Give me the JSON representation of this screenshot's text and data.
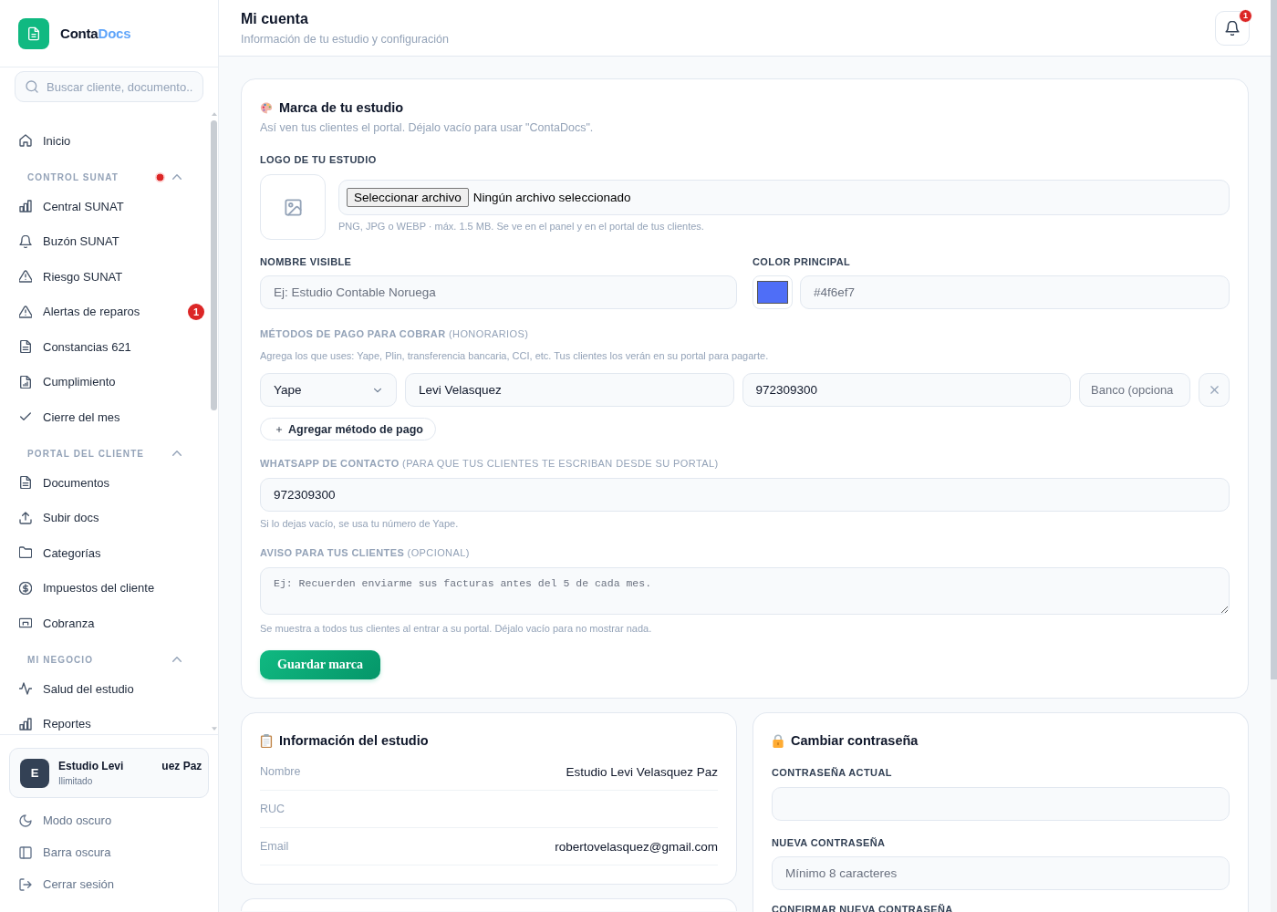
{
  "sidebar": {
    "brand": {
      "name_start": "Conta",
      "name_end": "Docs"
    },
    "search": {
      "placeholder": "Buscar cliente, documento.."
    },
    "nav_top": [
      {
        "label": "Inicio",
        "selected": false
      }
    ],
    "nav_sections": [
      {
        "title": "CONTROL SUNAT",
        "alert_dot": true,
        "expanded": true,
        "items": [
          {
            "label": "Central SUNAT",
            "selected": false
          },
          {
            "label": "Buzón SUNAT",
            "selected": false
          },
          {
            "label": "Riesgo SUNAT",
            "selected": false
          },
          {
            "label": "Alertas de reparos",
            "badge": "1",
            "selected": false
          },
          {
            "label": "Constancias 621",
            "selected": false
          },
          {
            "label": "Cumplimiento",
            "selected": false
          },
          {
            "label": "Cierre del mes",
            "selected": false
          }
        ]
      },
      {
        "title": "PORTAL DEL CLIENTE",
        "alert_dot": false,
        "expanded": true,
        "items": [
          {
            "label": "Documentos",
            "selected": false
          },
          {
            "label": "Subir docs",
            "selected": false
          },
          {
            "label": "Categorías",
            "selected": false
          },
          {
            "label": "Impuestos del cliente",
            "selected": false
          },
          {
            "label": "Cobranza",
            "selected": false
          }
        ]
      },
      {
        "title": "MI NEGOCIO",
        "alert_dot": false,
        "expanded": true,
        "items": [
          {
            "label": "Salud del estudio",
            "selected": false
          },
          {
            "label": "Reportes",
            "selected": false
          }
        ]
      }
    ],
    "account": {
      "initial": "E",
      "name_start": "Estudio Levi",
      "name_end": "uez Paz",
      "plan": "Ilimitado"
    },
    "footer_actions": [
      {
        "label": "Modo oscuro"
      },
      {
        "label": "Barra oscura"
      },
      {
        "label": "Cerrar sesión"
      }
    ]
  },
  "header": {
    "title": "Mi cuenta",
    "subtitle": "Información de tu estudio y configuración",
    "notifications": {
      "badge": "1"
    }
  },
  "brand_card": {
    "title": "Marca de tu estudio",
    "subtitle": "Así ven tus clientes el portal. Déjalo vacío para usar \"ContaDocs\".",
    "logo": {
      "label": "LOGO DE TU ESTUDIO",
      "file_button": "Seleccionar archivo",
      "file_status": "Ningún archivo seleccionado",
      "hint": "PNG, JPG o WEBP · máx. 1.5 MB. Se ve en el panel y en el portal de tus clientes."
    },
    "visible_name": {
      "label": "NOMBRE VISIBLE",
      "placeholder": "Ej: Estudio Contable Noruega"
    },
    "main_color": {
      "label": "COLOR PRINCIPAL",
      "color": "#4f6ef7",
      "placeholder": "#4f6ef7"
    },
    "payment": {
      "label": "**MÉTODOS DE PAGO PARA COBRAR** (HONORARIOS)",
      "hint": "Agrega los que uses: Yape, Plin, transferencia bancaria, CCI, etc. Tus clientes los verán en su portal para pagarte.",
      "methods": [
        {
          "type": "Yape",
          "holder": "Levi Velasquez",
          "number": "972309300",
          "bank_placeholder": "Banco (opciona"
        }
      ],
      "add_button": "Agregar método de pago"
    },
    "whatsapp": {
      "label": "**WHATSAPP DE CONTACTO** (PARA QUE TUS CLIENTES TE ESCRIBAN DESDE SU PORTAL)",
      "value": "972309300",
      "hint": "Si lo dejas vacío, se usa tu número de Yape."
    },
    "notice": {
      "label": "**AVISO PARA TUS CLIENTES** (OPCIONAL)",
      "placeholder": "Ej: Recuerden enviarme sus facturas antes del 5 de cada mes.",
      "hint": "Se muestra a todos tus clientes al entrar a su portal. Déjalo vacío para no mostrar nada."
    },
    "save_button": "Guardar marca"
  },
  "info_card": {
    "title": "Información del estudio",
    "rows": [
      {
        "label": "Nombre",
        "value": "Estudio Levi Velasquez Paz"
      },
      {
        "label": "RUC"
      },
      {
        "label": "Email",
        "value": "robertovelasquez@gmail.com"
      }
    ]
  },
  "password_card": {
    "title": "Cambiar contraseña",
    "fields": [
      {
        "kind": "input",
        "label": "CONTRASEÑA ACTUAL"
      },
      {
        "kind": "input",
        "label": "NUEVA CONTRASEÑA",
        "placeholder": "Mínimo 8 caracteres"
      },
      {
        "kind": "label",
        "label": "CONFIRMAR NUEVA CONTRASEÑA"
      }
    ]
  }
}
